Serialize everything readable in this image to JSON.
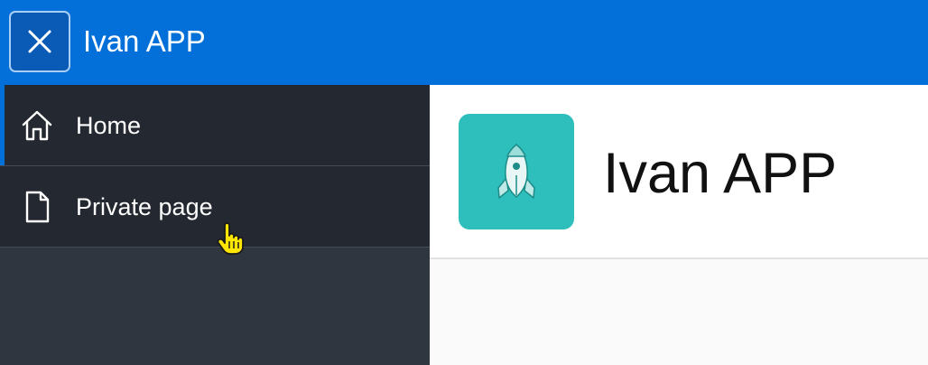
{
  "topbar": {
    "title": "Ivan APP",
    "close_icon": "close-icon",
    "background": "#0270d8"
  },
  "sidebar": {
    "items": [
      {
        "label": "Home",
        "icon": "home-icon",
        "active": true
      },
      {
        "label": "Private page",
        "icon": "document-icon",
        "active": false
      }
    ],
    "accent": "#0270d8"
  },
  "main": {
    "title": "Ivan APP",
    "logo_icon": "rocket-icon",
    "logo_color": "#2ebfbc"
  }
}
